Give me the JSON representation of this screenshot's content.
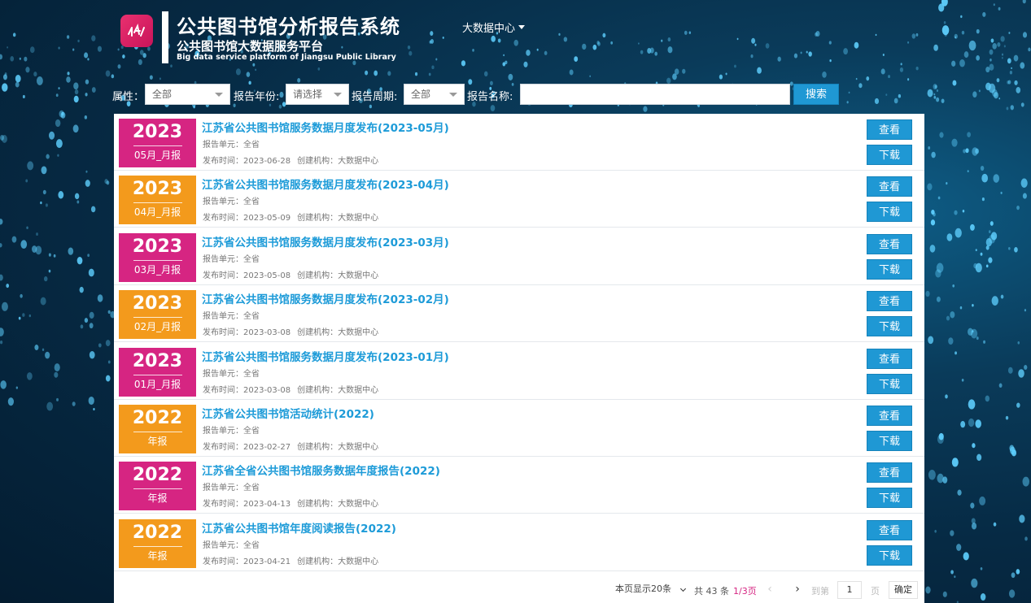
{
  "header": {
    "title": "公共图书馆分析报告系统",
    "subtitle": "公共图书馆大数据服务平台",
    "subtitle_en": "Big data service platform of Jiangsu Public Library",
    "center_menu": "大数据中心"
  },
  "filters": {
    "attr_label": "属性：",
    "attr_value": "全部",
    "year_label": "报告年份:",
    "year_value": "请选择",
    "cycle_label": "报告周期:",
    "cycle_value": "全部",
    "name_label": "报告名称:",
    "name_value": "",
    "search_label": "搜索"
  },
  "colors": {
    "pink": "#d62582",
    "orange": "#f39a1c",
    "accent": "#1f98d4"
  },
  "reports": [
    {
      "year": "2023",
      "period": "05月_月报",
      "color": "pink",
      "title": "江苏省公共图书馆服务数据月度发布(2023-05月)",
      "unit": "报告单元：全省",
      "date": "发布时间：2023-06-28",
      "org": "创建机构：大数据中心",
      "view": "查看",
      "download": "下载"
    },
    {
      "year": "2023",
      "period": "04月_月报",
      "color": "orange",
      "title": "江苏省公共图书馆服务数据月度发布(2023-04月)",
      "unit": "报告单元：全省",
      "date": "发布时间：2023-05-09",
      "org": "创建机构：大数据中心",
      "view": "查看",
      "download": "下载"
    },
    {
      "year": "2023",
      "period": "03月_月报",
      "color": "pink",
      "title": "江苏省公共图书馆服务数据月度发布(2023-03月)",
      "unit": "报告单元：全省",
      "date": "发布时间：2023-05-08",
      "org": "创建机构：大数据中心",
      "view": "查看",
      "download": "下载"
    },
    {
      "year": "2023",
      "period": "02月_月报",
      "color": "orange",
      "title": "江苏省公共图书馆服务数据月度发布(2023-02月)",
      "unit": "报告单元：全省",
      "date": "发布时间：2023-03-08",
      "org": "创建机构：大数据中心",
      "view": "查看",
      "download": "下载"
    },
    {
      "year": "2023",
      "period": "01月_月报",
      "color": "pink",
      "title": "江苏省公共图书馆服务数据月度发布(2023-01月)",
      "unit": "报告单元：全省",
      "date": "发布时间：2023-03-08",
      "org": "创建机构：大数据中心",
      "view": "查看",
      "download": "下载"
    },
    {
      "year": "2022",
      "period": "年报",
      "color": "orange",
      "title": "江苏省公共图书馆活动统计(2022)",
      "unit": "报告单元：全省",
      "date": "发布时间：2023-02-27",
      "org": "创建机构：大数据中心",
      "view": "查看",
      "download": "下载"
    },
    {
      "year": "2022",
      "period": "年报",
      "color": "pink",
      "title": "江苏省全省公共图书馆服务数据年度报告(2022)",
      "unit": "报告单元：全省",
      "date": "发布时间：2023-04-13",
      "org": "创建机构：大数据中心",
      "view": "查看",
      "download": "下载"
    },
    {
      "year": "2022",
      "period": "年报",
      "color": "orange",
      "title": "江苏省公共图书馆年度阅读报告(2022)",
      "unit": "报告单元：全省",
      "date": "发布时间：2023-04-21",
      "org": "创建机构：大数据中心",
      "view": "查看",
      "download": "下载"
    }
  ],
  "pagination": {
    "page_size": "本页显示20条",
    "total": "共 43 条",
    "current": "1/3页",
    "goto_label": "到第",
    "goto_value": "1",
    "page_unit": "页",
    "confirm": "确定"
  }
}
